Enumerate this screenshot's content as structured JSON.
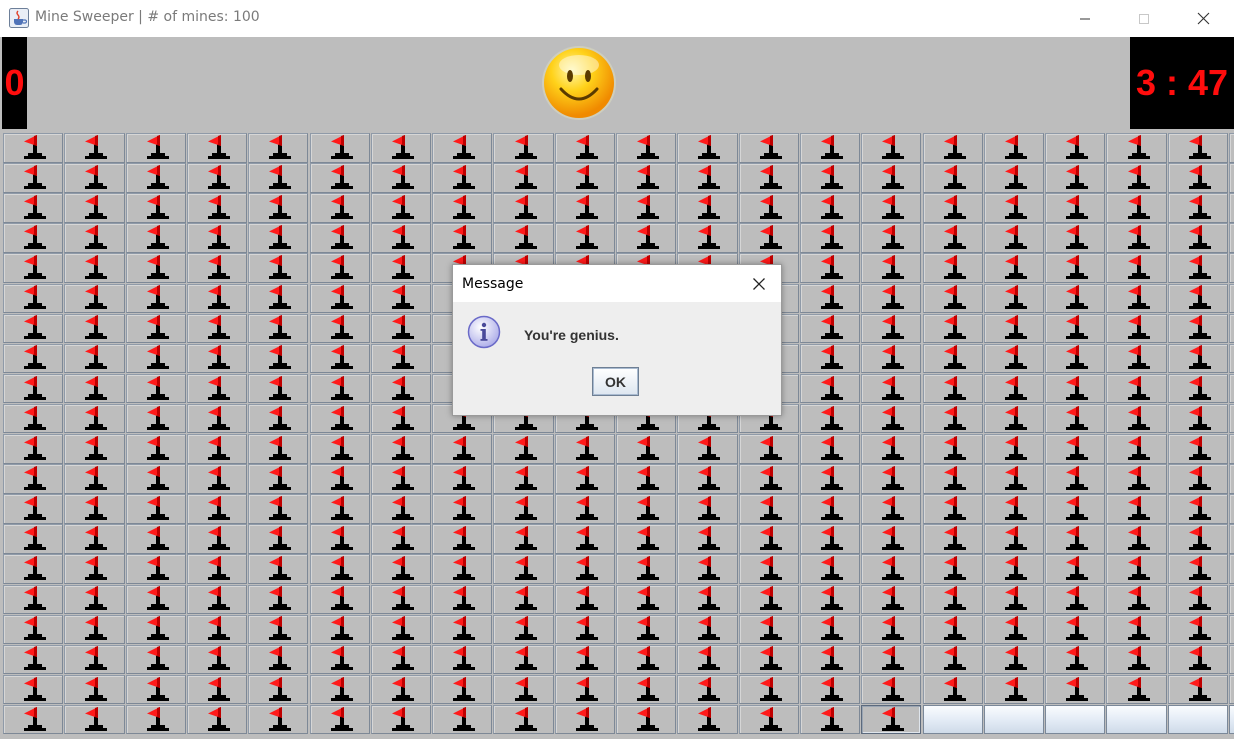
{
  "window": {
    "title": "Mine Sweeper | # of mines: 100",
    "app_icon": "java-cup-icon",
    "controls": [
      "minimize-icon",
      "maximize-icon",
      "close-icon"
    ]
  },
  "header": {
    "mine_counter": "0",
    "smiley_icon": "smiley-face-icon",
    "timer": "3 : 47",
    "display_color": "#ff0d0d"
  },
  "board": {
    "columns": 20,
    "rows": 20,
    "flag_icon": "red-flag-icon",
    "last_row_states": [
      "flagged",
      "flagged",
      "flagged",
      "flagged",
      "flagged",
      "flagged",
      "flagged",
      "flagged",
      "flagged",
      "flagged",
      "flagged",
      "flagged",
      "flagged",
      "flagged",
      "flagged-pressed",
      "open",
      "open",
      "open",
      "open",
      "open",
      "open"
    ]
  },
  "dialog": {
    "title": "Message",
    "icon": "info-icon",
    "message": "You're genius.",
    "ok_label": "OK"
  }
}
